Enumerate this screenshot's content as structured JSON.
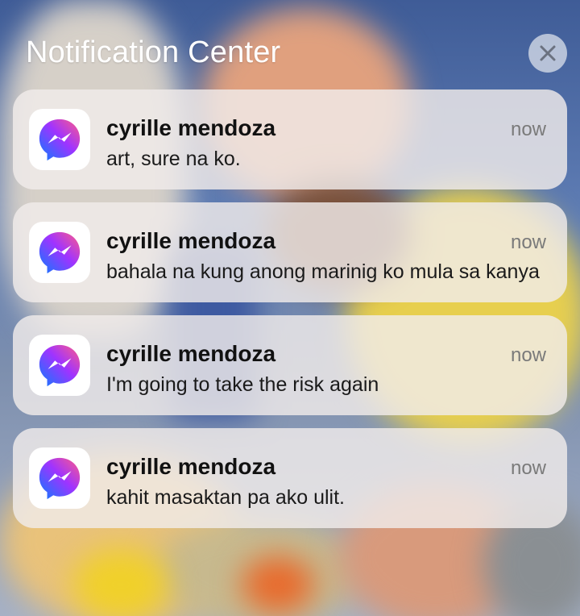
{
  "header": {
    "title": "Notification Center",
    "close_icon": "close-icon"
  },
  "notifications": [
    {
      "app_icon": "messenger-icon",
      "sender": "cyrille mendoza",
      "time": "now",
      "message": "art, sure na ko."
    },
    {
      "app_icon": "messenger-icon",
      "sender": "cyrille mendoza",
      "time": "now",
      "message": "bahala na kung anong marinig ko mula sa kanya"
    },
    {
      "app_icon": "messenger-icon",
      "sender": "cyrille mendoza",
      "time": "now",
      "message": "I'm going to take the risk again"
    },
    {
      "app_icon": "messenger-icon",
      "sender": "cyrille mendoza",
      "time": "now",
      "message": "kahit masaktan pa ako ulit."
    }
  ],
  "colors": {
    "card_background": "#f0ecea",
    "messenger_gradient_start": "#0a7cff",
    "messenger_gradient_mid": "#a033ff",
    "messenger_gradient_end": "#ff5c87"
  }
}
